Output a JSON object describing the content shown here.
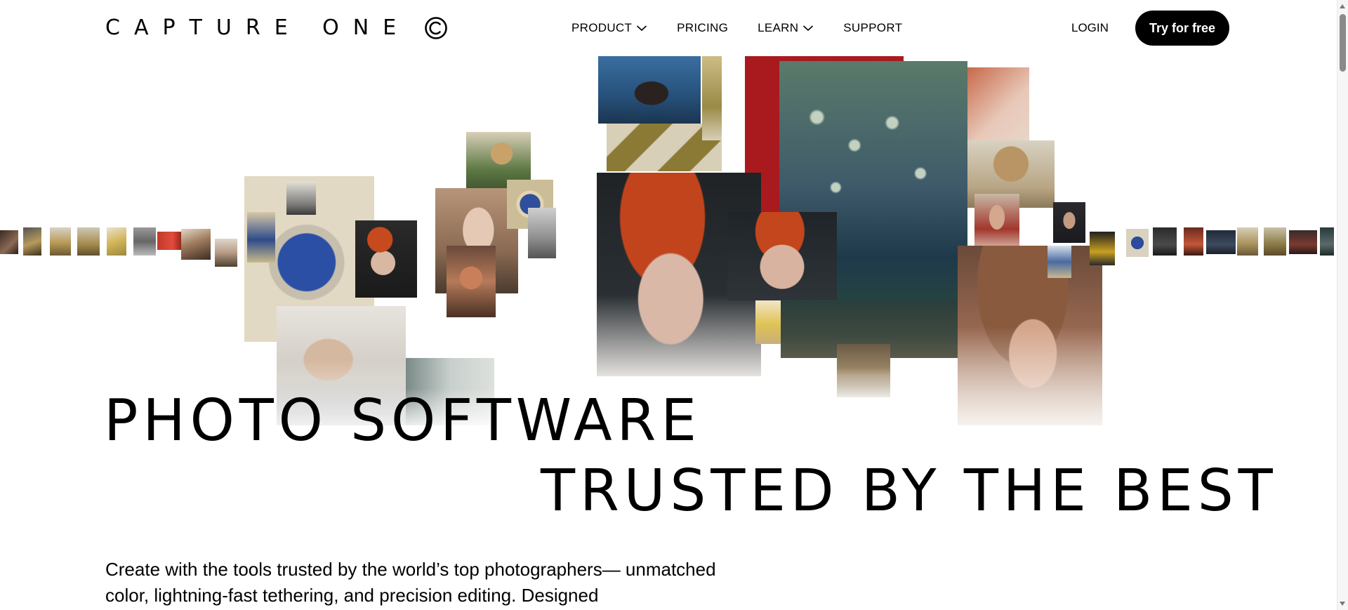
{
  "brand": {
    "logo_text": "CAPTURE ONE"
  },
  "nav": {
    "items": [
      {
        "label": "PRODUCT",
        "has_dropdown": true
      },
      {
        "label": "PRICING",
        "has_dropdown": false
      },
      {
        "label": "LEARN",
        "has_dropdown": true
      },
      {
        "label": "SUPPORT",
        "has_dropdown": false
      }
    ],
    "login_label": "LOGIN",
    "cta_label": "Try for free"
  },
  "hero": {
    "headline_line_1": "PHOTO SOFTWARE",
    "headline_line_2": "TRUSTED BY THE BEST",
    "intro_text": "Create with the tools trusted by the world’s top photographers— unmatched color, lightning-fast tethering, and precision editing. Designed"
  },
  "colors": {
    "text": "#000000",
    "background": "#ffffff",
    "cta_background": "#000000",
    "cta_text": "#ffffff"
  },
  "icons": {
    "logo_mark": "capture-one-logo-icon",
    "dropdown": "chevron-down-icon"
  }
}
